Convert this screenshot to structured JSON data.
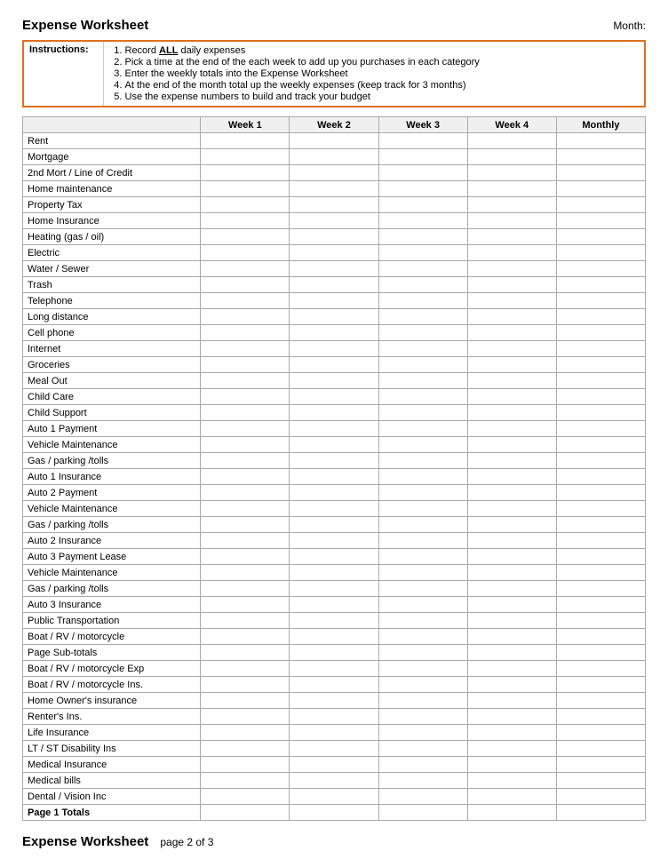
{
  "header": {
    "title": "Expense Worksheet",
    "month_label": "Month:",
    "footer_title": "Expense Worksheet",
    "footer_sub": "page 2 of 3"
  },
  "instructions": {
    "label": "Instructions:",
    "steps": [
      "Record ALL daily expenses",
      "Pick a time at the end of the each week to add up you purchases in each category",
      "Enter the weekly totals into the Expense Worksheet",
      "At the end of the month total up the weekly expenses (keep track for 3 months)",
      "Use the expense numbers to build and track your budget"
    ]
  },
  "columns": [
    "Week 1",
    "Week 2",
    "Week 3",
    "Week 4",
    "Monthly"
  ],
  "rows": [
    {
      "label": "Rent",
      "bold": false
    },
    {
      "label": "Mortgage",
      "bold": false
    },
    {
      "label": "2nd Mort / Line of Credit",
      "bold": false
    },
    {
      "label": "Home maintenance",
      "bold": false
    },
    {
      "label": "Property Tax",
      "bold": false
    },
    {
      "label": "Home Insurance",
      "bold": false
    },
    {
      "label": "Heating (gas / oil)",
      "bold": false
    },
    {
      "label": "Electric",
      "bold": false
    },
    {
      "label": "Water / Sewer",
      "bold": false
    },
    {
      "label": "Trash",
      "bold": false
    },
    {
      "label": "Telephone",
      "bold": false
    },
    {
      "label": "Long distance",
      "bold": false
    },
    {
      "label": "Cell phone",
      "bold": false
    },
    {
      "label": "Internet",
      "bold": false
    },
    {
      "label": "Groceries",
      "bold": false
    },
    {
      "label": "Meal Out",
      "bold": false
    },
    {
      "label": "Child Care",
      "bold": false
    },
    {
      "label": "Child Support",
      "bold": false
    },
    {
      "label": "Auto 1 Payment",
      "bold": false
    },
    {
      "label": "Vehicle Maintenance",
      "bold": false
    },
    {
      "label": "Gas / parking /tolls",
      "bold": false
    },
    {
      "label": "Auto 1 Insurance",
      "bold": false
    },
    {
      "label": "Auto 2 Payment",
      "bold": false
    },
    {
      "label": "Vehicle Maintenance",
      "bold": false
    },
    {
      "label": "Gas / parking /tolls",
      "bold": false
    },
    {
      "label": "Auto 2 Insurance",
      "bold": false
    },
    {
      "label": "Auto 3 Payment Lease",
      "bold": false
    },
    {
      "label": "Vehicle Maintenance",
      "bold": false
    },
    {
      "label": "Gas / parking /tolls",
      "bold": false
    },
    {
      "label": "Auto 3 Insurance",
      "bold": false
    },
    {
      "label": "Public Transportation",
      "bold": false
    },
    {
      "label": "Boat / RV / motorcycle",
      "bold": false
    },
    {
      "label": "Page Sub-totals",
      "bold": false
    },
    {
      "label": "Boat / RV / motorcycle Exp",
      "bold": false
    },
    {
      "label": "Boat / RV / motorcycle Ins.",
      "bold": false
    },
    {
      "label": "Home Owner's insurance",
      "bold": false
    },
    {
      "label": "Renter's Ins.",
      "bold": false
    },
    {
      "label": "Life Insurance",
      "bold": false
    },
    {
      "label": "LT / ST Disability Ins",
      "bold": false
    },
    {
      "label": "Medical Insurance",
      "bold": false
    },
    {
      "label": "Medical bills",
      "bold": false
    },
    {
      "label": "Dental / Vision Inc",
      "bold": false
    },
    {
      "label": "Page 1 Totals",
      "bold": true
    }
  ]
}
